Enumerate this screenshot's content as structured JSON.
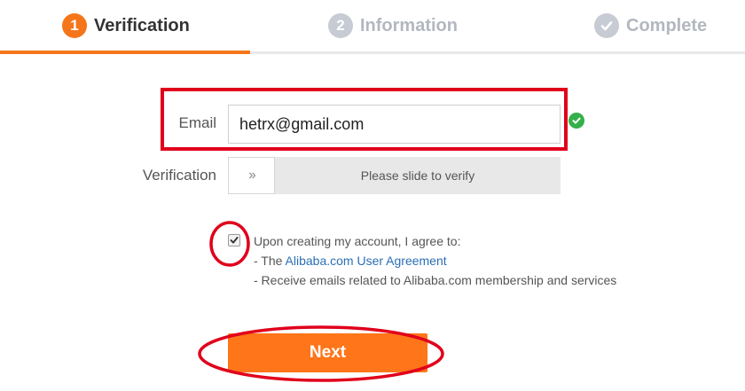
{
  "steps": [
    {
      "number": "1",
      "label": "Verification",
      "state": "active"
    },
    {
      "number": "2",
      "label": "Information",
      "state": "inactive"
    },
    {
      "icon": "check-icon",
      "label": "Complete",
      "state": "inactive"
    }
  ],
  "form": {
    "email_label": "Email",
    "email_value": "hetrx@gmail.com",
    "verification_label": "Verification",
    "slider_text": "Please slide to verify",
    "slider_handle_icon": "double-chevron-right-icon"
  },
  "agreement": {
    "checked": true,
    "intro": "Upon creating my account, I agree to:",
    "line1_prefix": "- The ",
    "line1_link": "Alibaba.com User Agreement",
    "line2": "- Receive emails related to Alibaba.com membership and services"
  },
  "next_label": "Next",
  "colors": {
    "accent": "#f5761a",
    "button": "#ff7519",
    "link": "#2b6fb5",
    "annotation": "#e0001b",
    "valid": "#34b04a"
  }
}
